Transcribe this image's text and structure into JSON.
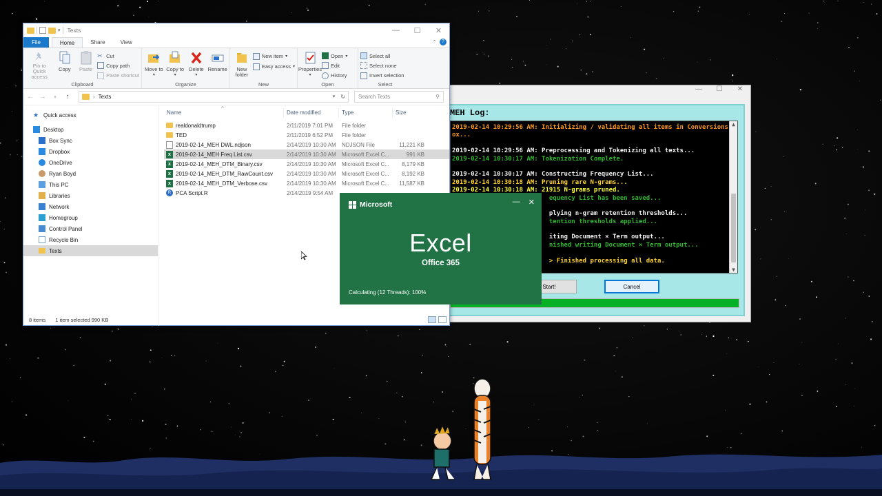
{
  "explorer": {
    "title": "Texts",
    "tabs": [
      "File",
      "Home",
      "Share",
      "View"
    ],
    "ribbon": {
      "clipboard": {
        "pin_label": "Pin to Quick access",
        "copy_label": "Copy",
        "paste_label": "Paste",
        "cut_label": "Cut",
        "copy_path_label": "Copy path",
        "paste_shortcut_label": "Paste shortcut",
        "group_label": "Clipboard"
      },
      "organize": {
        "move_label": "Move to",
        "copyto_label": "Copy to",
        "delete_label": "Delete",
        "rename_label": "Rename",
        "group_label": "Organize"
      },
      "new": {
        "new_folder_label": "New folder",
        "new_item_label": "New item",
        "easy_access_label": "Easy access",
        "group_label": "New"
      },
      "open": {
        "properties_label": "Properties",
        "open_label": "Open",
        "edit_label": "Edit",
        "history_label": "History",
        "group_label": "Open"
      },
      "select": {
        "select_all_label": "Select all",
        "select_none_label": "Select none",
        "invert_label": "Invert selection",
        "group_label": "Select"
      }
    },
    "address": "Texts",
    "search_placeholder": "Search Texts",
    "nav": [
      {
        "label": "Quick access",
        "icon": "star-icon",
        "level": 0
      },
      {
        "label": "Desktop",
        "icon": "desktop-icon",
        "level": 0
      },
      {
        "label": "Box Sync",
        "icon": "box-sync-icon",
        "level": 1
      },
      {
        "label": "Dropbox",
        "icon": "dropbox-icon",
        "level": 1
      },
      {
        "label": "OneDrive",
        "icon": "onedrive-icon",
        "level": 1
      },
      {
        "label": "Ryan Boyd",
        "icon": "user-icon",
        "level": 1
      },
      {
        "label": "This PC",
        "icon": "pc-icon",
        "level": 1
      },
      {
        "label": "Libraries",
        "icon": "library-icon",
        "level": 1
      },
      {
        "label": "Network",
        "icon": "network-icon",
        "level": 1
      },
      {
        "label": "Homegroup",
        "icon": "homegroup-icon",
        "level": 1
      },
      {
        "label": "Control Panel",
        "icon": "control-panel-icon",
        "level": 1
      },
      {
        "label": "Recycle Bin",
        "icon": "recycle-bin-icon",
        "level": 1
      },
      {
        "label": "Texts",
        "icon": "folder-icon",
        "level": 1,
        "selected": true
      }
    ],
    "columns": {
      "name": "Name",
      "date": "Date modified",
      "type": "Type",
      "size": "Size"
    },
    "files": [
      {
        "name": "realdonaldtrump",
        "date": "2/11/2019 7:01 PM",
        "type": "File folder",
        "size": "",
        "kind": "folder"
      },
      {
        "name": "TED",
        "date": "2/11/2019 6:52 PM",
        "type": "File folder",
        "size": "",
        "kind": "folder"
      },
      {
        "name": "2019-02-14_MEH DWL.ndjson",
        "date": "2/14/2019 10:30 AM",
        "type": "NDJSON File",
        "size": "11,221 KB",
        "kind": "file"
      },
      {
        "name": "2019-02-14_MEH Freq List.csv",
        "date": "2/14/2019 10:30 AM",
        "type": "Microsoft Excel C...",
        "size": "991 KB",
        "kind": "excel",
        "selected": true
      },
      {
        "name": "2019-02-14_MEH_DTM_Binary.csv",
        "date": "2/14/2019 10:30 AM",
        "type": "Microsoft Excel C...",
        "size": "8,179 KB",
        "kind": "excel"
      },
      {
        "name": "2019-02-14_MEH_DTM_RawCount.csv",
        "date": "2/14/2019 10:30 AM",
        "type": "Microsoft Excel C...",
        "size": "8,192 KB",
        "kind": "excel"
      },
      {
        "name": "2019-02-14_MEH_DTM_Verbose.csv",
        "date": "2/14/2019 10:30 AM",
        "type": "Microsoft Excel C...",
        "size": "11,587 KB",
        "kind": "excel"
      },
      {
        "name": "PCA Script.R",
        "date": "2/14/2019 9:54 AM",
        "type": "",
        "size": "",
        "kind": "r"
      }
    ],
    "status": {
      "count": "8 items",
      "selection": "1 item selected  990 KB"
    }
  },
  "meh": {
    "label": "MEH Log:",
    "log": [
      {
        "text": "2019-02-14 10:29:56 AM: Initializing / validating all items in Conversions",
        "color": "orange"
      },
      {
        "text": "ox...",
        "color": "orange"
      },
      {
        "text": "",
        "color": "blank"
      },
      {
        "text": "2019-02-14 10:29:56 AM: Preprocessing and Tokenizing all texts...",
        "color": "white"
      },
      {
        "text": "2019-02-14 10:30:17 AM: Tokenization Complete.",
        "color": "green"
      },
      {
        "text": "",
        "color": "blank"
      },
      {
        "text": "2019-02-14 10:30:17 AM: Constructing Frequency List...",
        "color": "white"
      },
      {
        "text": "2019-02-14 10:30:18 AM: Pruning rare N-grams...",
        "color": "yellow"
      },
      {
        "text": "2019-02-14 10:30:18 AM: 21915 N-grams pruned.",
        "color": "bright"
      },
      {
        "text": "                          equency List has been saved...",
        "color": "green"
      },
      {
        "text": "",
        "color": "blank"
      },
      {
        "text": "                          plying n-gram retention thresholds...",
        "color": "white"
      },
      {
        "text": "                          tention thresholds applied...",
        "color": "green"
      },
      {
        "text": "",
        "color": "blank"
      },
      {
        "text": "                          iting Document × Term output...",
        "color": "white"
      },
      {
        "text": "                          nished writing Document × Term output...",
        "color": "green"
      },
      {
        "text": "",
        "color": "blank"
      },
      {
        "text": "                          > Finished processing all data.",
        "color": "yellow"
      }
    ],
    "start_label": "Start!",
    "cancel_label": "Cancel",
    "progress": 1.0
  },
  "splash": {
    "brand": "Microsoft",
    "app": "Excel",
    "edition": "Office 365",
    "status": "Calculating (12 Threads): 100%"
  },
  "colors": {
    "excel_green": "#217346",
    "file_tab": "#1979ca",
    "progress_green": "#06b025",
    "meh_bg": "#a7e7e7"
  }
}
